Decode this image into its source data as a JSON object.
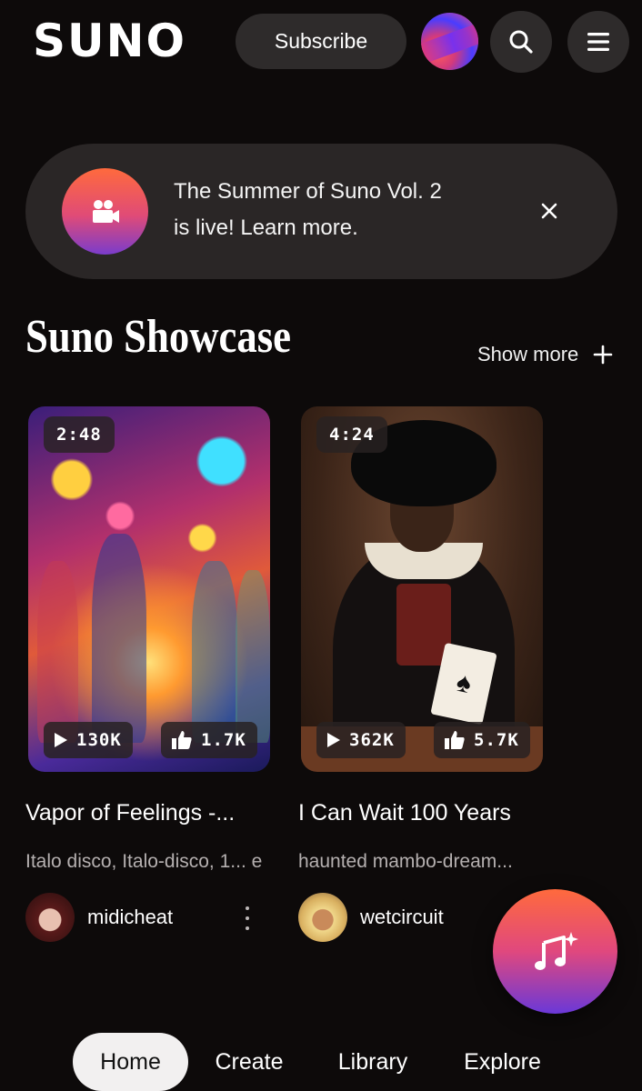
{
  "header": {
    "logo": "SUNO",
    "subscribe_label": "Subscribe",
    "icons": [
      "avatar",
      "search-icon",
      "menu-icon"
    ]
  },
  "banner": {
    "text_line1": "The Summer of Suno Vol. 2",
    "text_line2": "is live! Learn more.",
    "icon": "video-camera-icon",
    "close_icon": "close-icon"
  },
  "section": {
    "title": "Suno Showcase",
    "show_more": "Show more"
  },
  "cards": [
    {
      "duration": "2:48",
      "plays": "130K",
      "likes": "1.7K",
      "title": "Vapor of Feelings -...",
      "tags": "Italo disco, Italo-disco, 1... e",
      "creator": "midicheat"
    },
    {
      "duration": "4:24",
      "plays": "362K",
      "likes": "5.7K",
      "title": "I Can Wait 100 Years",
      "tags": "haunted mambo-dream...",
      "creator": "wetcircuit"
    }
  ],
  "nav": {
    "home": "Home",
    "create": "Create",
    "library": "Library",
    "explore": "Explore"
  },
  "colors": {
    "background": "#0d0a0a",
    "surface": "#2e2b2b",
    "accent_orange": "#ff6a3d",
    "accent_purple": "#6a38d8"
  }
}
